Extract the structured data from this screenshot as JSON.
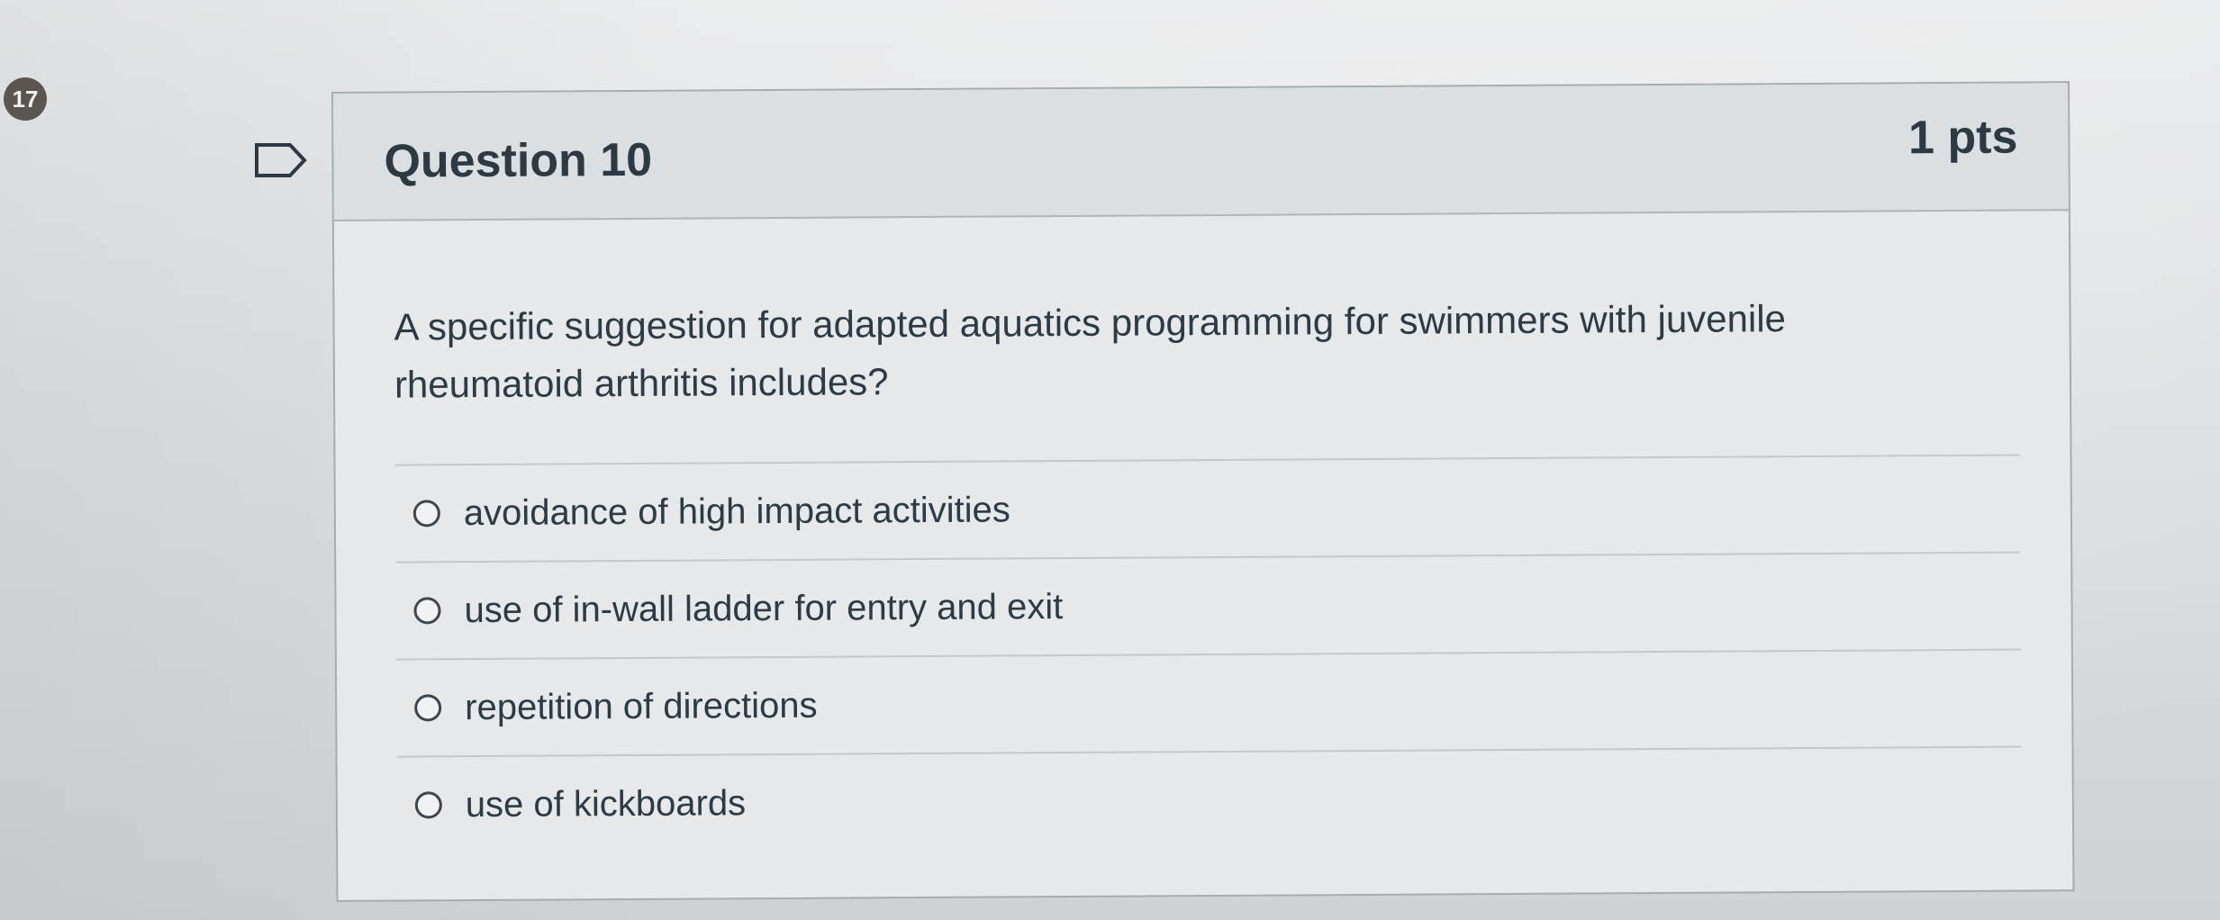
{
  "badge": {
    "count": "17"
  },
  "icons": {
    "flag": "flag-outline-icon",
    "radio": "radio-circle-icon"
  },
  "question": {
    "title": "Question 10",
    "points": "1 pts",
    "text": "A specific suggestion for adapted aquatics programming for swimmers with juvenile rheumatoid arthritis includes?",
    "answers": [
      {
        "label": "avoidance of high impact activities"
      },
      {
        "label": "use of in-wall ladder for entry and exit"
      },
      {
        "label": "repetition of directions"
      },
      {
        "label": "use of kickboards"
      }
    ]
  }
}
